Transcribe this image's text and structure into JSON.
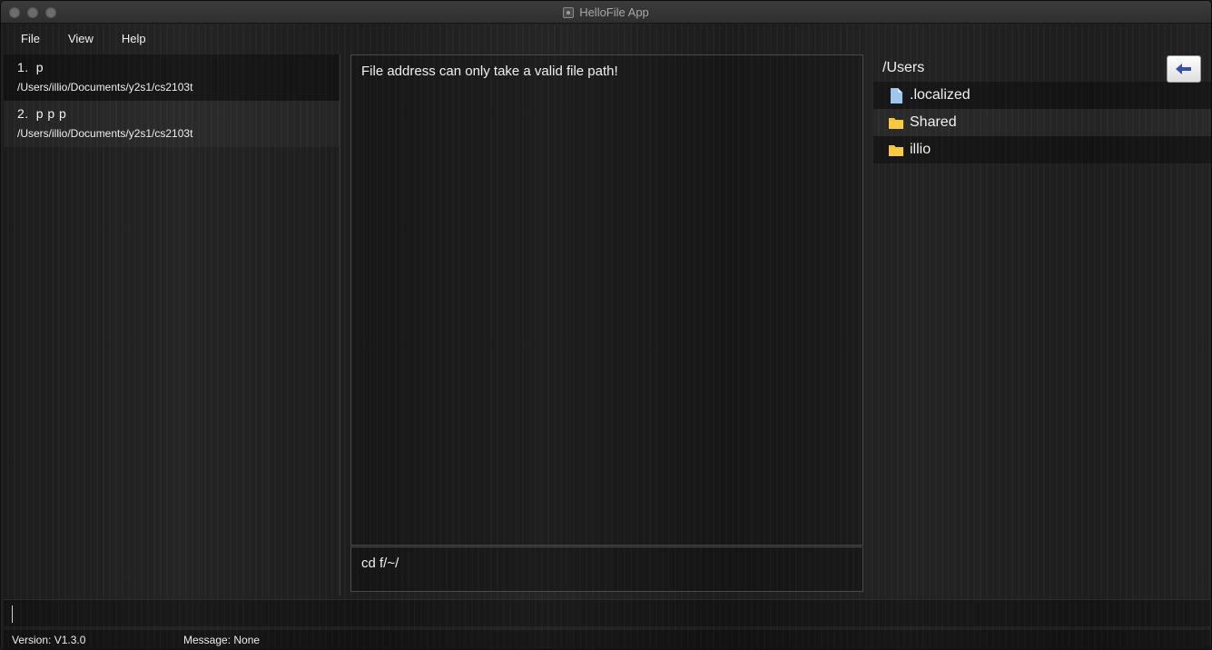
{
  "window": {
    "title": "HelloFile App"
  },
  "menu": {
    "items": [
      "File",
      "View",
      "Help"
    ]
  },
  "tagged_files": [
    {
      "index": "1.",
      "name": "p",
      "path": "/Users/illio/Documents/y2s1/cs2103t"
    },
    {
      "index": "2.",
      "name": "p p p",
      "path": "/Users/illio/Documents/y2s1/cs2103t"
    }
  ],
  "result_display": {
    "text": "File address can only take a valid file path!"
  },
  "command_echo": {
    "text": "cd f/~/"
  },
  "file_explorer": {
    "current_path": "/Users",
    "back_button_icon": "arrow-left-icon",
    "entries": [
      {
        "name": ".localized",
        "icon": "document-icon",
        "icon_color": "#9fc6ee"
      },
      {
        "name": "Shared",
        "icon": "folder-icon",
        "icon_color": "#f7c52f"
      },
      {
        "name": "illio",
        "icon": "folder-icon",
        "icon_color": "#f7c52f"
      }
    ]
  },
  "command_box": {
    "value": ""
  },
  "status": {
    "version": "Version:  V1.3.0",
    "message": "Message:  None"
  }
}
